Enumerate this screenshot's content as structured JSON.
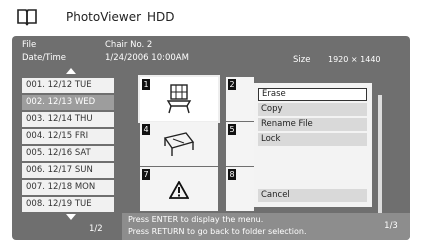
{
  "header": {
    "app_title": "PhotoViewer",
    "source": "HDD"
  },
  "info": {
    "file_label": "File",
    "date_label": "Date/Time",
    "file_name": "Chair No. 2",
    "date_time": "1/24/2006 10:00AM",
    "size_label": "Size",
    "size_value": "1920 × 1440"
  },
  "date_list": {
    "items": [
      "001. 12/12 TUE",
      "002. 12/13 WED",
      "003. 12/14 THU",
      "004. 12/15 FRI",
      "005. 12/16 SAT",
      "006. 12/17 SUN",
      "007. 12/18 MON",
      "008. 12/19 TUE"
    ],
    "selected_index": 1,
    "page": "1/2"
  },
  "thumbnails": {
    "numbers": [
      "1",
      "2",
      "4",
      "5",
      "7",
      "8"
    ],
    "selected": "1"
  },
  "context_menu": {
    "items": [
      "Erase",
      "Copy",
      "Rename File",
      "Lock"
    ],
    "cancel": "Cancel",
    "selected": "Erase"
  },
  "hint": {
    "line1": "Press ENTER to display the menu.",
    "line2": "Press RETURN to go back to folder selection."
  },
  "grid_page": "1/3"
}
